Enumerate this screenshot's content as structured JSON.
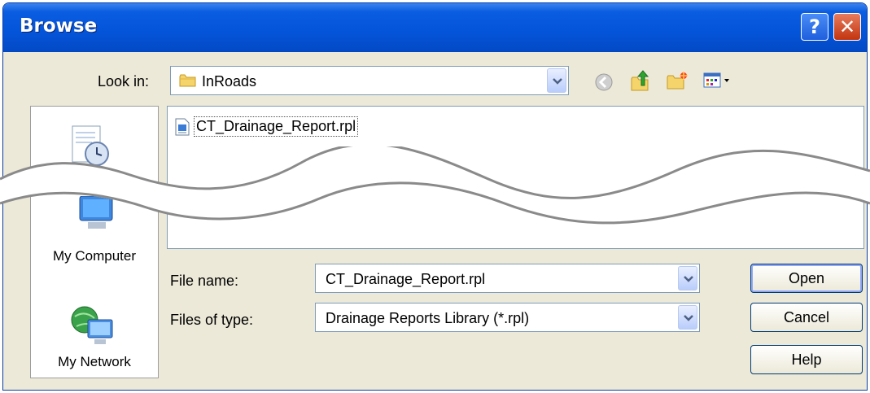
{
  "window": {
    "title": "Browse",
    "help_symbol": "?",
    "close_symbol": "✕"
  },
  "lookin": {
    "label": "Look in:",
    "value": "InRoads"
  },
  "toolbar": {
    "icons": [
      "back-icon",
      "up-folder-icon",
      "new-folder-icon",
      "view-menu-icon"
    ]
  },
  "places": [
    {
      "label": "My Computer",
      "icon": "my-computer-icon"
    },
    {
      "label": "My Network",
      "icon": "my-network-icon"
    }
  ],
  "files": [
    {
      "name": "CT_Drainage_Report.rpl",
      "icon": "report-file-icon"
    }
  ],
  "filename": {
    "label": "File name:",
    "value": "CT_Drainage_Report.rpl"
  },
  "filetype": {
    "label": "Files of type:",
    "value": "Drainage Reports Library (*.rpl)"
  },
  "buttons": {
    "open": "Open",
    "cancel": "Cancel",
    "help": "Help"
  },
  "colors": {
    "title_bar": "#0454d9",
    "dialog_bg": "#ece9d8",
    "list_bg": "#ffffff",
    "field_border": "#7f9db9"
  }
}
